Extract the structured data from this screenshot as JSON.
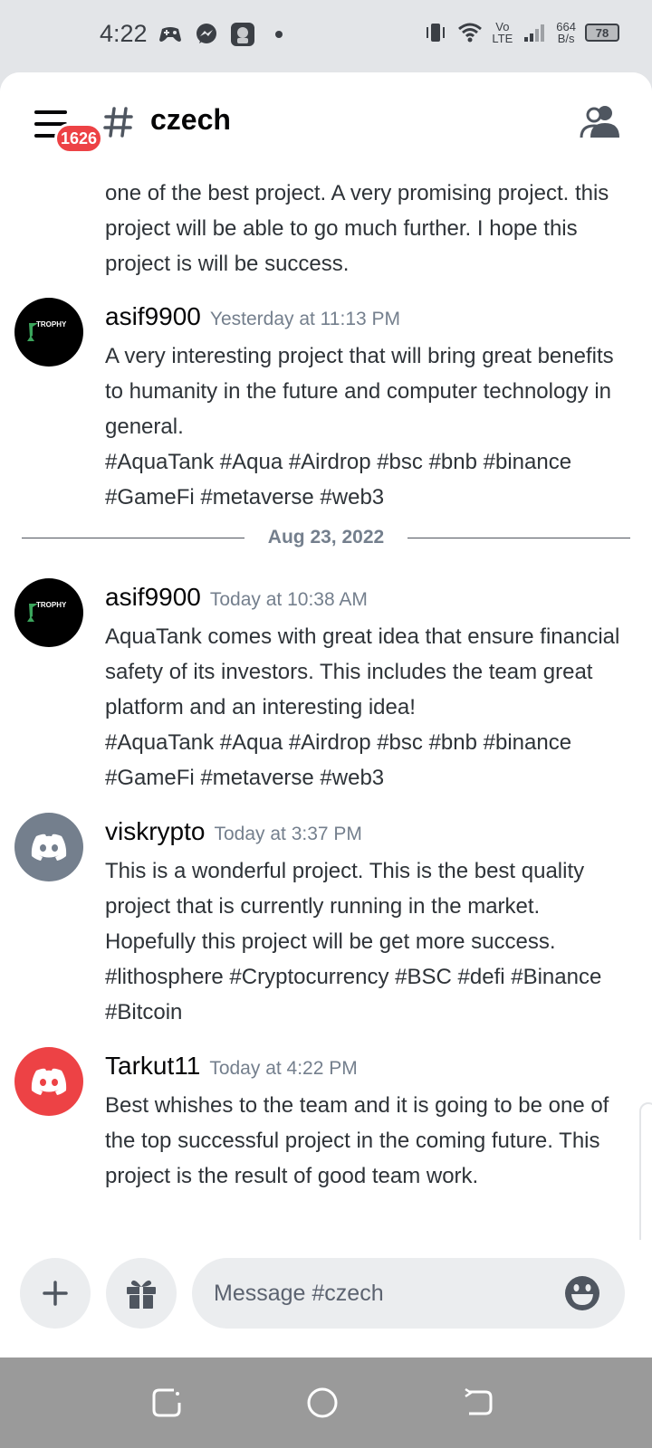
{
  "status_bar": {
    "time": "4:22",
    "network_speed_value": "664",
    "network_speed_unit": "B/s",
    "volte_top": "Vo",
    "volte_bottom": "LTE",
    "battery": "78",
    "icons": [
      "game-controller-icon",
      "messenger-icon",
      "app-icon",
      "dot-icon",
      "vibrate-icon",
      "wifi-icon",
      "signal-icon"
    ]
  },
  "header": {
    "hash": "#",
    "channel_name": "czech",
    "badge_count": "1626"
  },
  "messages": [
    {
      "author": "",
      "timestamp": "",
      "text": "one of the best project. A very promising project. this project will be able to go much further. I hope this project is will be success."
    },
    {
      "author": "asif9900",
      "timestamp": "Yesterday at 11:13 PM",
      "avatar_text": "TROPHY",
      "text": "A very interesting project that will bring great benefits to humanity in the future and computer technology in general.",
      "tags": "#AquaTank #Aqua #Airdrop #bsc #bnb #binance #GameFi #metaverse #web3"
    },
    {
      "divider": "Aug 23, 2022"
    },
    {
      "author": "asif9900",
      "timestamp": "Today at 10:38 AM",
      "avatar_text": "TROPHY",
      "text": "AquaTank  comes with great idea that ensure financial safety of its investors. This includes the team great platform and an interesting idea!",
      "tags": "#AquaTank #Aqua #Airdrop #bsc #bnb #binance #GameFi #metaverse #web3"
    },
    {
      "author": "viskrypto",
      "timestamp": "Today at 3:37 PM",
      "text": "This is a wonderful project. This is the best quality project that is currently running in the market. Hopefully this project will be get more success.",
      "tags": "#lithosphere #Cryptocurrency #BSC #defi #Binance #Bitcoin"
    },
    {
      "author": "Tarkut11",
      "timestamp": "Today at 4:22 PM",
      "text": "Best whishes to the team and it is going to be one of the top successful project in the coming future. This project is the result of good team work."
    }
  ],
  "composer": {
    "placeholder": "Message #czech"
  },
  "colors": {
    "accent_red": "#ed4245",
    "discord_gray": "#747f8d",
    "trophy_green": "#3ba55c"
  }
}
